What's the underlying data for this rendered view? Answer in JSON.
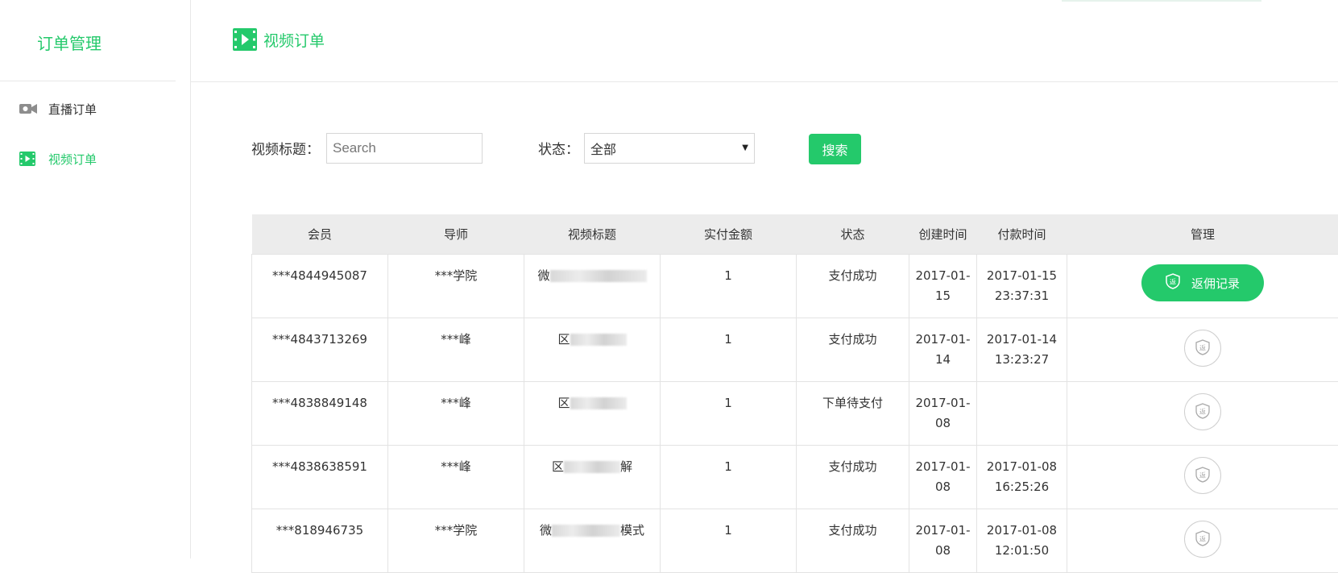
{
  "sidebar": {
    "title": "订单管理",
    "items": [
      {
        "label": "直播订单",
        "icon": "video-camera-icon",
        "active": false
      },
      {
        "label": "视频订单",
        "icon": "film-icon",
        "active": true
      }
    ]
  },
  "header": {
    "title": "视频订单",
    "icon": "film-icon"
  },
  "filters": {
    "title_label": "视频标题：",
    "title_placeholder": "Search",
    "status_label": "状态：",
    "status_value": "全部",
    "search_button": "搜索"
  },
  "table": {
    "columns": [
      "会员",
      "导师",
      "视频标题",
      "实付金额",
      "状态",
      "创建时间",
      "付款时间",
      "管理"
    ],
    "rows": [
      {
        "member": "***4844945087",
        "mentor": "***学院",
        "title_prefix": "微",
        "title_suffix": "",
        "amount": "1",
        "status": "支付成功",
        "created": "2017-01-15",
        "paid": "2017-01-15 23:37:31",
        "action": "返佣记录",
        "action_enabled": true
      },
      {
        "member": "***4843713269",
        "mentor": "***峰",
        "title_prefix": "区",
        "title_suffix": "",
        "amount": "1",
        "status": "支付成功",
        "created": "2017-01-14",
        "paid": "2017-01-14 13:23:27",
        "action": "返",
        "action_enabled": false
      },
      {
        "member": "***4838849148",
        "mentor": "***峰",
        "title_prefix": "区",
        "title_suffix": "",
        "amount": "1",
        "status": "下单待支付",
        "created": "2017-01-08",
        "paid": "",
        "action": "返",
        "action_enabled": false
      },
      {
        "member": "***4838638591",
        "mentor": "***峰",
        "title_prefix": "区",
        "title_suffix": "解",
        "amount": "1",
        "status": "支付成功",
        "created": "2017-01-08",
        "paid": "2017-01-08 16:25:26",
        "action": "返",
        "action_enabled": false
      },
      {
        "member": "***818946735",
        "mentor": "***学院",
        "title_prefix": "微",
        "title_suffix": "模式",
        "amount": "1",
        "status": "支付成功",
        "created": "2017-01-08",
        "paid": "2017-01-08 12:01:50",
        "action": "返",
        "action_enabled": false
      }
    ]
  },
  "colors": {
    "accent": "#24c96b",
    "header_bg": "#ececec",
    "border": "#e3e3e3"
  }
}
